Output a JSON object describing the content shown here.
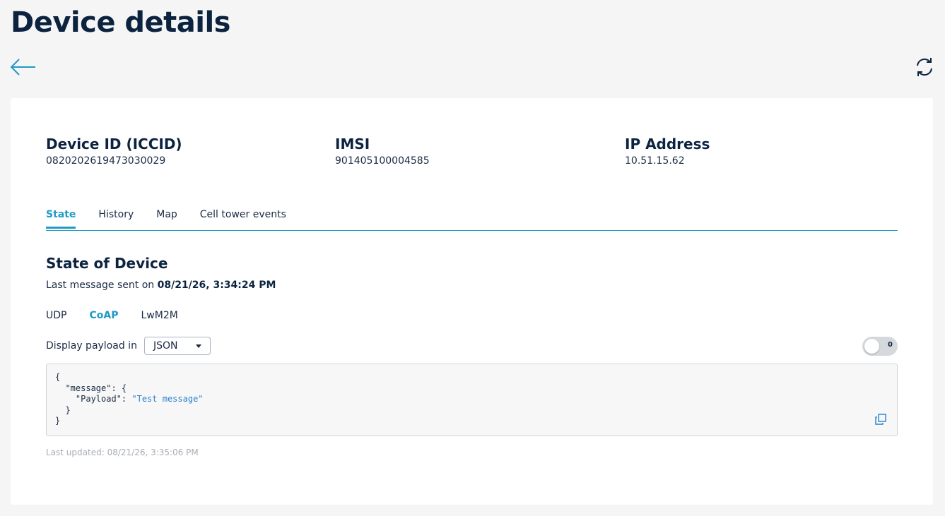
{
  "header": {
    "title": "Device details"
  },
  "icons": {
    "back": "arrow-left-icon",
    "refresh": "refresh-icon",
    "copy": "copy-icon"
  },
  "device": {
    "fields": [
      {
        "label": "Device ID (ICCID)",
        "value": "0820202619473030029"
      },
      {
        "label": "IMSI",
        "value": "901405100004585"
      },
      {
        "label": "IP Address",
        "value": "10.51.15.62"
      }
    ]
  },
  "tabs": [
    {
      "label": "State",
      "active": true
    },
    {
      "label": "History",
      "active": false
    },
    {
      "label": "Map",
      "active": false
    },
    {
      "label": "Cell tower events",
      "active": false
    }
  ],
  "state": {
    "title": "State of Device",
    "last_message_prefix": "Last message sent on ",
    "last_message_time": "08/21/26, 3:34:24 PM",
    "protocols": [
      {
        "label": "UDP",
        "active": false
      },
      {
        "label": "CoAP",
        "active": true
      },
      {
        "label": "LwM2M",
        "active": false
      }
    ],
    "payload_label": "Display payload in",
    "payload_format": "JSON",
    "toggle_label": "0",
    "toggle_on": false,
    "code": {
      "line1": "{",
      "line2": "  \"message\": {",
      "line3_key": "    \"Payload\": ",
      "line3_value": "\"Test message\"",
      "line4": "  }",
      "line5": "}"
    },
    "last_updated": "Last updated: 08/21/26, 3:35:06 PM"
  },
  "colors": {
    "accent": "#1f9bc6",
    "title": "#0c2340",
    "json_string": "#2a7fcf",
    "muted": "#a8adb3"
  }
}
